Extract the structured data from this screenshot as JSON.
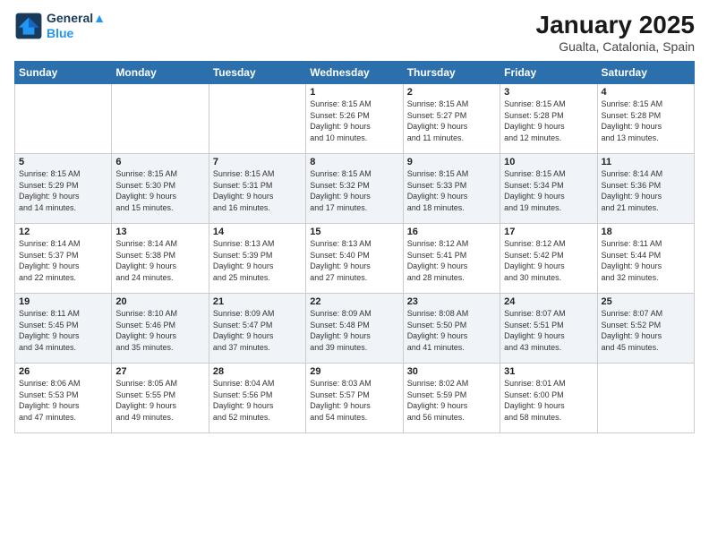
{
  "logo": {
    "line1": "General",
    "line2": "Blue"
  },
  "title": "January 2025",
  "subtitle": "Gualta, Catalonia, Spain",
  "weekdays": [
    "Sunday",
    "Monday",
    "Tuesday",
    "Wednesday",
    "Thursday",
    "Friday",
    "Saturday"
  ],
  "weeks": [
    [
      {
        "day": "",
        "info": ""
      },
      {
        "day": "",
        "info": ""
      },
      {
        "day": "",
        "info": ""
      },
      {
        "day": "1",
        "info": "Sunrise: 8:15 AM\nSunset: 5:26 PM\nDaylight: 9 hours\nand 10 minutes."
      },
      {
        "day": "2",
        "info": "Sunrise: 8:15 AM\nSunset: 5:27 PM\nDaylight: 9 hours\nand 11 minutes."
      },
      {
        "day": "3",
        "info": "Sunrise: 8:15 AM\nSunset: 5:28 PM\nDaylight: 9 hours\nand 12 minutes."
      },
      {
        "day": "4",
        "info": "Sunrise: 8:15 AM\nSunset: 5:28 PM\nDaylight: 9 hours\nand 13 minutes."
      }
    ],
    [
      {
        "day": "5",
        "info": "Sunrise: 8:15 AM\nSunset: 5:29 PM\nDaylight: 9 hours\nand 14 minutes."
      },
      {
        "day": "6",
        "info": "Sunrise: 8:15 AM\nSunset: 5:30 PM\nDaylight: 9 hours\nand 15 minutes."
      },
      {
        "day": "7",
        "info": "Sunrise: 8:15 AM\nSunset: 5:31 PM\nDaylight: 9 hours\nand 16 minutes."
      },
      {
        "day": "8",
        "info": "Sunrise: 8:15 AM\nSunset: 5:32 PM\nDaylight: 9 hours\nand 17 minutes."
      },
      {
        "day": "9",
        "info": "Sunrise: 8:15 AM\nSunset: 5:33 PM\nDaylight: 9 hours\nand 18 minutes."
      },
      {
        "day": "10",
        "info": "Sunrise: 8:15 AM\nSunset: 5:34 PM\nDaylight: 9 hours\nand 19 minutes."
      },
      {
        "day": "11",
        "info": "Sunrise: 8:14 AM\nSunset: 5:36 PM\nDaylight: 9 hours\nand 21 minutes."
      }
    ],
    [
      {
        "day": "12",
        "info": "Sunrise: 8:14 AM\nSunset: 5:37 PM\nDaylight: 9 hours\nand 22 minutes."
      },
      {
        "day": "13",
        "info": "Sunrise: 8:14 AM\nSunset: 5:38 PM\nDaylight: 9 hours\nand 24 minutes."
      },
      {
        "day": "14",
        "info": "Sunrise: 8:13 AM\nSunset: 5:39 PM\nDaylight: 9 hours\nand 25 minutes."
      },
      {
        "day": "15",
        "info": "Sunrise: 8:13 AM\nSunset: 5:40 PM\nDaylight: 9 hours\nand 27 minutes."
      },
      {
        "day": "16",
        "info": "Sunrise: 8:12 AM\nSunset: 5:41 PM\nDaylight: 9 hours\nand 28 minutes."
      },
      {
        "day": "17",
        "info": "Sunrise: 8:12 AM\nSunset: 5:42 PM\nDaylight: 9 hours\nand 30 minutes."
      },
      {
        "day": "18",
        "info": "Sunrise: 8:11 AM\nSunset: 5:44 PM\nDaylight: 9 hours\nand 32 minutes."
      }
    ],
    [
      {
        "day": "19",
        "info": "Sunrise: 8:11 AM\nSunset: 5:45 PM\nDaylight: 9 hours\nand 34 minutes."
      },
      {
        "day": "20",
        "info": "Sunrise: 8:10 AM\nSunset: 5:46 PM\nDaylight: 9 hours\nand 35 minutes."
      },
      {
        "day": "21",
        "info": "Sunrise: 8:09 AM\nSunset: 5:47 PM\nDaylight: 9 hours\nand 37 minutes."
      },
      {
        "day": "22",
        "info": "Sunrise: 8:09 AM\nSunset: 5:48 PM\nDaylight: 9 hours\nand 39 minutes."
      },
      {
        "day": "23",
        "info": "Sunrise: 8:08 AM\nSunset: 5:50 PM\nDaylight: 9 hours\nand 41 minutes."
      },
      {
        "day": "24",
        "info": "Sunrise: 8:07 AM\nSunset: 5:51 PM\nDaylight: 9 hours\nand 43 minutes."
      },
      {
        "day": "25",
        "info": "Sunrise: 8:07 AM\nSunset: 5:52 PM\nDaylight: 9 hours\nand 45 minutes."
      }
    ],
    [
      {
        "day": "26",
        "info": "Sunrise: 8:06 AM\nSunset: 5:53 PM\nDaylight: 9 hours\nand 47 minutes."
      },
      {
        "day": "27",
        "info": "Sunrise: 8:05 AM\nSunset: 5:55 PM\nDaylight: 9 hours\nand 49 minutes."
      },
      {
        "day": "28",
        "info": "Sunrise: 8:04 AM\nSunset: 5:56 PM\nDaylight: 9 hours\nand 52 minutes."
      },
      {
        "day": "29",
        "info": "Sunrise: 8:03 AM\nSunset: 5:57 PM\nDaylight: 9 hours\nand 54 minutes."
      },
      {
        "day": "30",
        "info": "Sunrise: 8:02 AM\nSunset: 5:59 PM\nDaylight: 9 hours\nand 56 minutes."
      },
      {
        "day": "31",
        "info": "Sunrise: 8:01 AM\nSunset: 6:00 PM\nDaylight: 9 hours\nand 58 minutes."
      },
      {
        "day": "",
        "info": ""
      }
    ]
  ]
}
